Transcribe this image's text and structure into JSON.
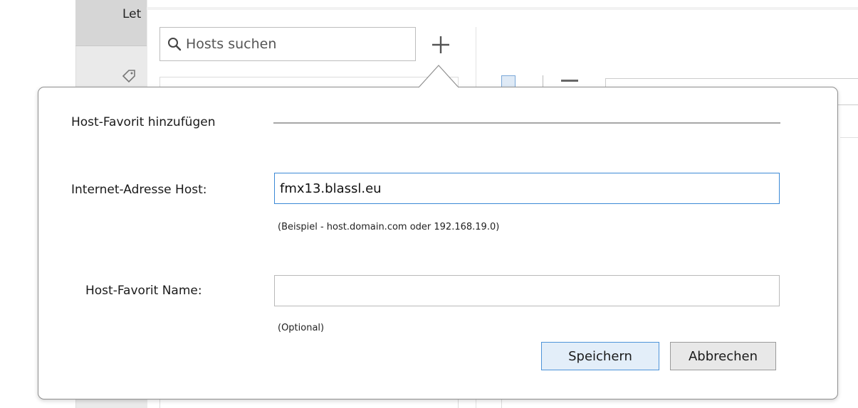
{
  "background": {
    "sidebar_label": "Let",
    "search": {
      "placeholder": "Hosts suchen"
    }
  },
  "dialog": {
    "section_title": "Host-Favorit hinzufügen",
    "host_address": {
      "label": "Internet-Adresse Host:",
      "value": "fmx13.blassl.eu",
      "hint": "(Beispiel - host.domain.com oder 192.168.19.0)"
    },
    "favorite_name": {
      "label": "Host-Favorit Name:",
      "value": "",
      "hint": "(Optional)"
    },
    "buttons": {
      "save": "Speichern",
      "cancel": "Abbrechen"
    }
  },
  "icons": {
    "search": "search-icon",
    "add": "plus-icon",
    "sidebar": "tag-icon"
  },
  "colors": {
    "focus_border": "#3b89d6",
    "primary_button_bg": "#e3eef9",
    "primary_button_border": "#4d93d9"
  }
}
